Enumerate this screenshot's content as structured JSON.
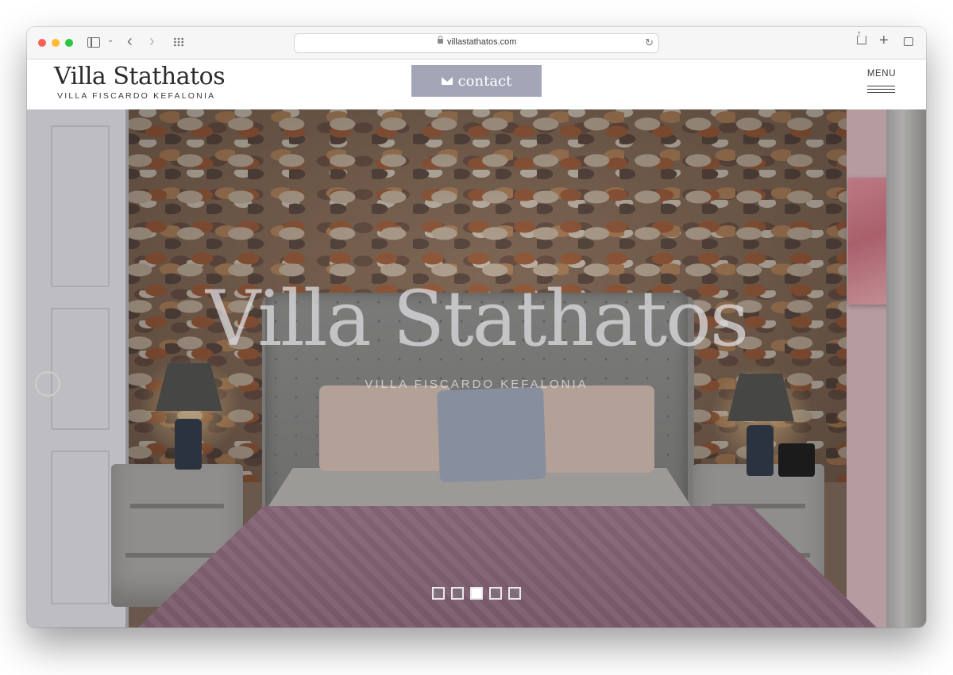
{
  "browser": {
    "url": "villastathatos.com"
  },
  "header": {
    "logo_title": "Villa Stathatos",
    "logo_subtitle": "VILLA FISCARDO KEFALONIA",
    "contact_label": "contact",
    "menu_label": "MENU"
  },
  "hero": {
    "title": "Villa Stathatos",
    "subtitle": "VILLA FISCARDO KEFALONIA",
    "slides": [
      {
        "active": false
      },
      {
        "active": false
      },
      {
        "active": true
      },
      {
        "active": false
      },
      {
        "active": false
      }
    ]
  },
  "colors": {
    "contact_button": "#a3a6b6",
    "text_dark": "#2b2b2b"
  },
  "icons": [
    "sidebar-icon",
    "chevron-down-icon",
    "back-icon",
    "forward-icon",
    "tab-overview-icon",
    "lock-icon",
    "reload-icon",
    "share-icon",
    "new-tab-icon",
    "tabs-icon",
    "envelope-icon",
    "hamburger-icon"
  ]
}
